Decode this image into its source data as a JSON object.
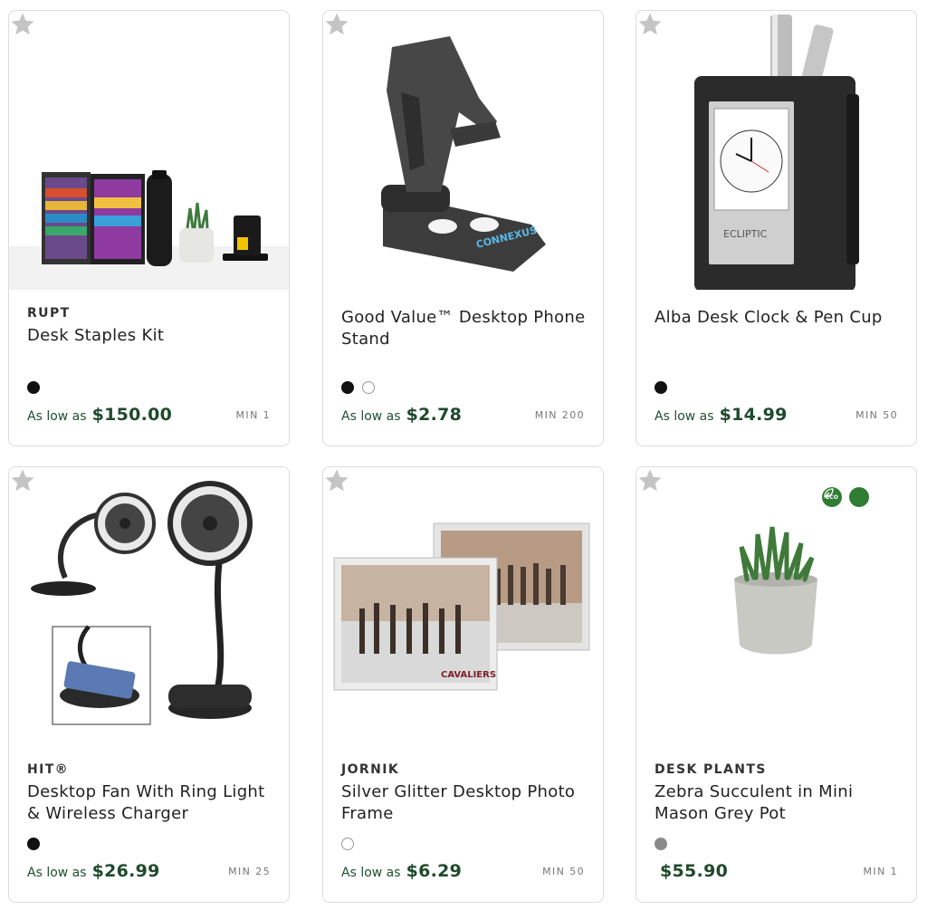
{
  "colors": {
    "price_green": "#1f4a2c",
    "eco_green": "#2e7d32",
    "star_gray": "#c4c4c4"
  },
  "products": [
    {
      "brand": "RUPT",
      "title": "Desk Staples Kit",
      "swatches": [
        "#111111"
      ],
      "price_prefix": "As low as",
      "price": "$150.00",
      "min": "MIN 1",
      "icons": [
        "favorite-star-icon"
      ]
    },
    {
      "brand": "",
      "title": "Good Value™ Desktop Phone Stand",
      "swatches": [
        "#111111",
        "#ffffff"
      ],
      "price_prefix": "As low as",
      "price": "$2.78",
      "min": "MIN 200",
      "icons": [
        "favorite-star-icon"
      ],
      "imprint_text": "CONNEXUS"
    },
    {
      "brand": "",
      "title": "Alba Desk Clock & Pen Cup",
      "swatches": [
        "#111111"
      ],
      "price_prefix": "As low as",
      "price": "$14.99",
      "min": "MIN 50",
      "icons": [
        "favorite-star-icon"
      ],
      "imprint_text": "ECLIPTIC"
    },
    {
      "brand": "HIT®",
      "title": "Desktop Fan With Ring Light & Wireless Charger",
      "swatches": [
        "#111111"
      ],
      "price_prefix": "As low as",
      "price": "$26.99",
      "min": "MIN 25",
      "icons": [
        "favorite-star-icon"
      ]
    },
    {
      "brand": "JORNIK",
      "title": "Silver Glitter Desktop Photo Frame",
      "swatches": [
        "#ffffff"
      ],
      "price_prefix": "As low as",
      "price": "$6.29",
      "min": "MIN 50",
      "icons": [
        "favorite-star-icon"
      ],
      "imprint_text": "CAVALIERS"
    },
    {
      "brand": "DESK PLANTS",
      "title": "Zebra Succulent in Mini Mason Grey Pot",
      "swatches": [
        "#8a8a8a"
      ],
      "price_prefix": "",
      "price": "$55.90",
      "min": "MIN 1",
      "icons": [
        "eco-badge-icon",
        "leaf-badge-icon",
        "favorite-star-icon"
      ],
      "eco_label": "ECO"
    }
  ]
}
